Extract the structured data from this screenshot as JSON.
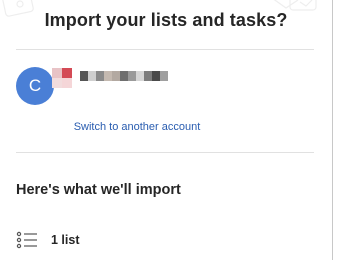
{
  "dialog": {
    "title": "Import your lists and tasks?"
  },
  "account": {
    "avatar_initial": "C",
    "avatar_color": "#4a7fd6",
    "switch_link_label": "Switch to another account"
  },
  "import_summary": {
    "heading": "Here's what we'll import",
    "items": [
      {
        "icon": "list-icon",
        "label": "1 list"
      }
    ]
  }
}
